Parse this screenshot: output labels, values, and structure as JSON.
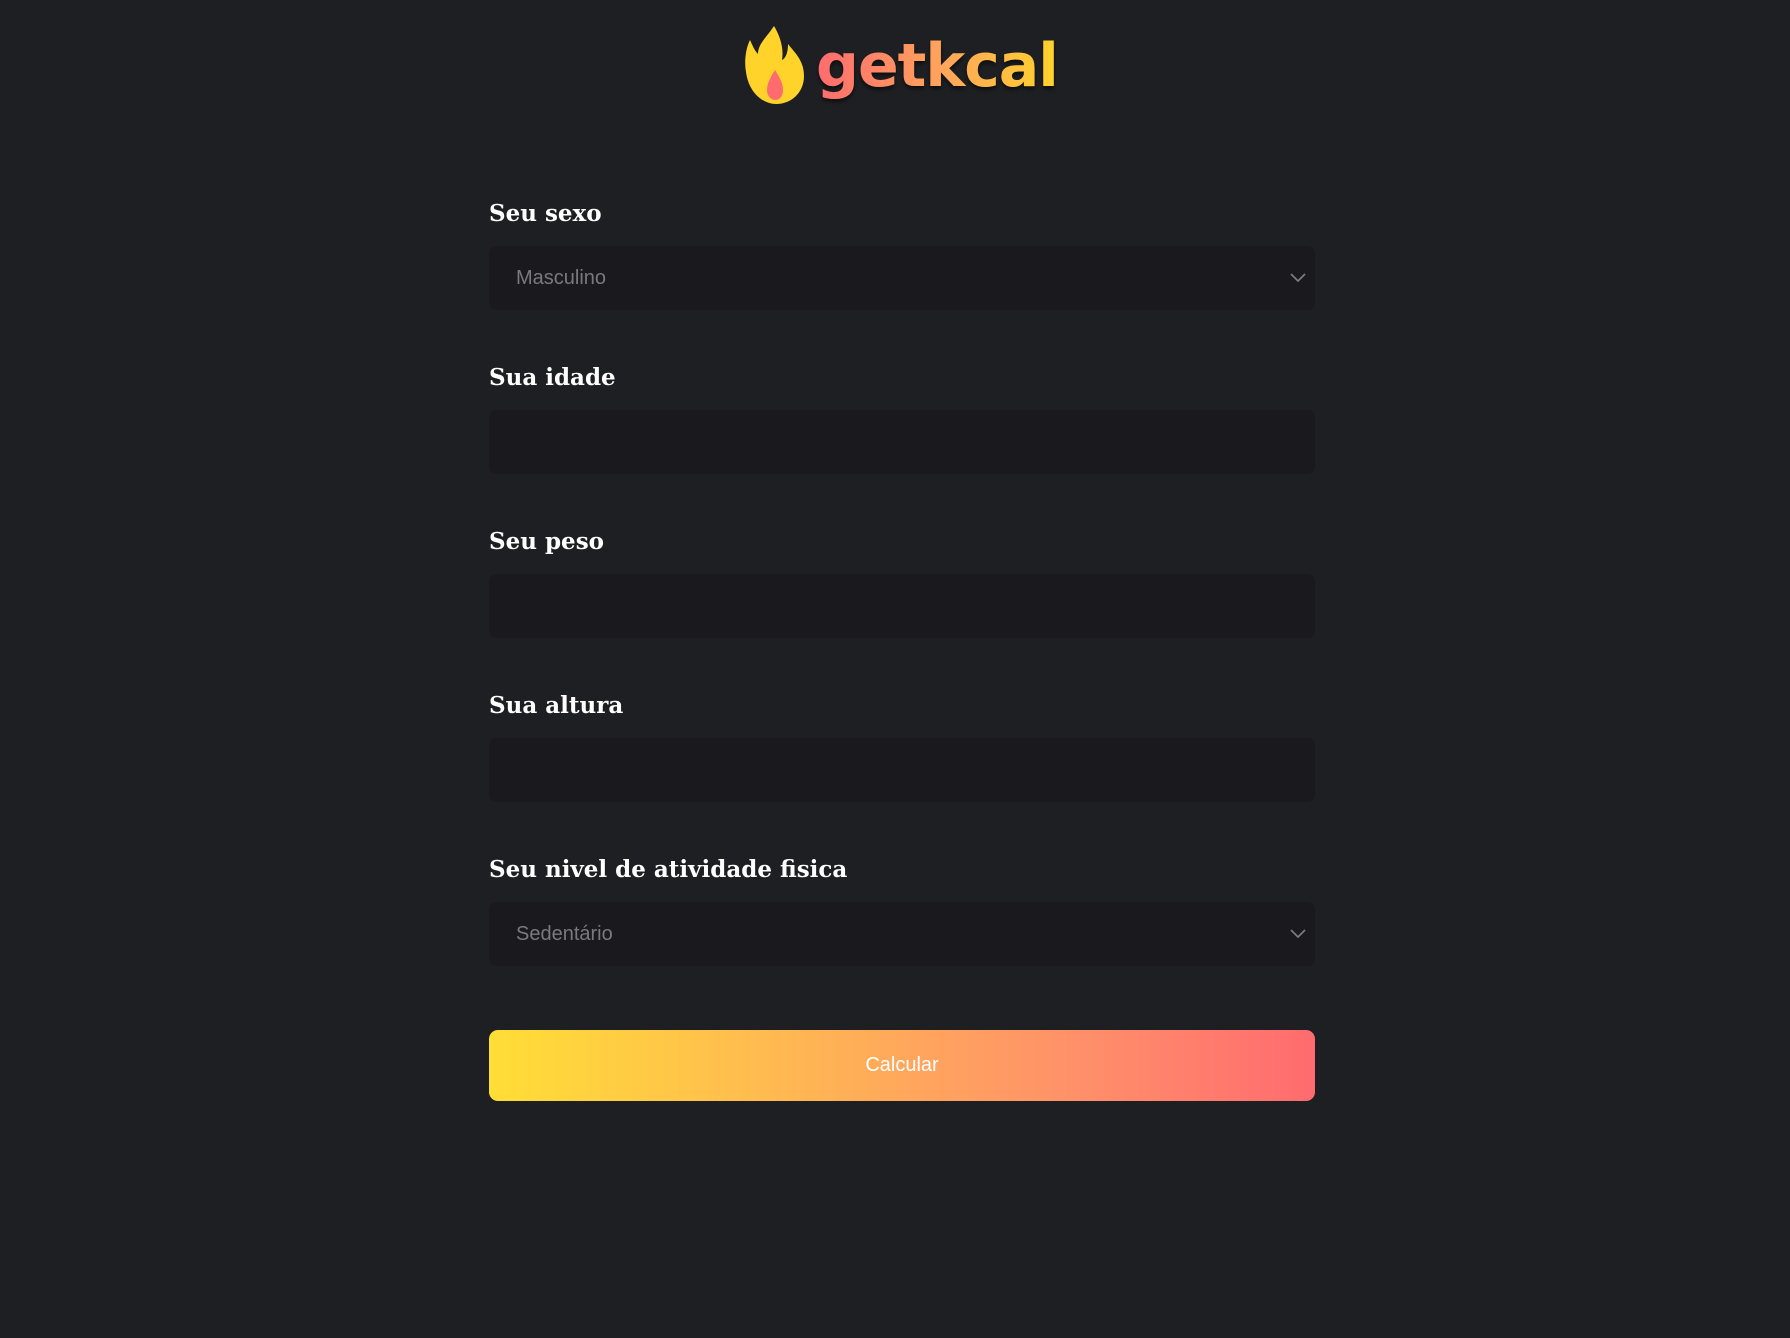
{
  "brand": {
    "name": "getkcal",
    "colors": {
      "gradient_start": "#ff6b6f",
      "gradient_mid": "#ffb355",
      "gradient_end": "#ffde36",
      "flame_outer": "#ffd32a",
      "flame_inner": "#ff6b6f"
    }
  },
  "form": {
    "sex": {
      "label": "Seu sexo",
      "value": "Masculino"
    },
    "age": {
      "label": "Sua idade",
      "value": ""
    },
    "weight": {
      "label": "Seu peso",
      "value": ""
    },
    "height": {
      "label": "Sua altura",
      "value": ""
    },
    "activity": {
      "label": "Seu nivel de atividade fisica",
      "value": "Sedentário"
    },
    "submit_label": "Calcular"
  },
  "icons": {
    "logo": "flame-icon",
    "select_indicator": "chevron-down-icon"
  }
}
